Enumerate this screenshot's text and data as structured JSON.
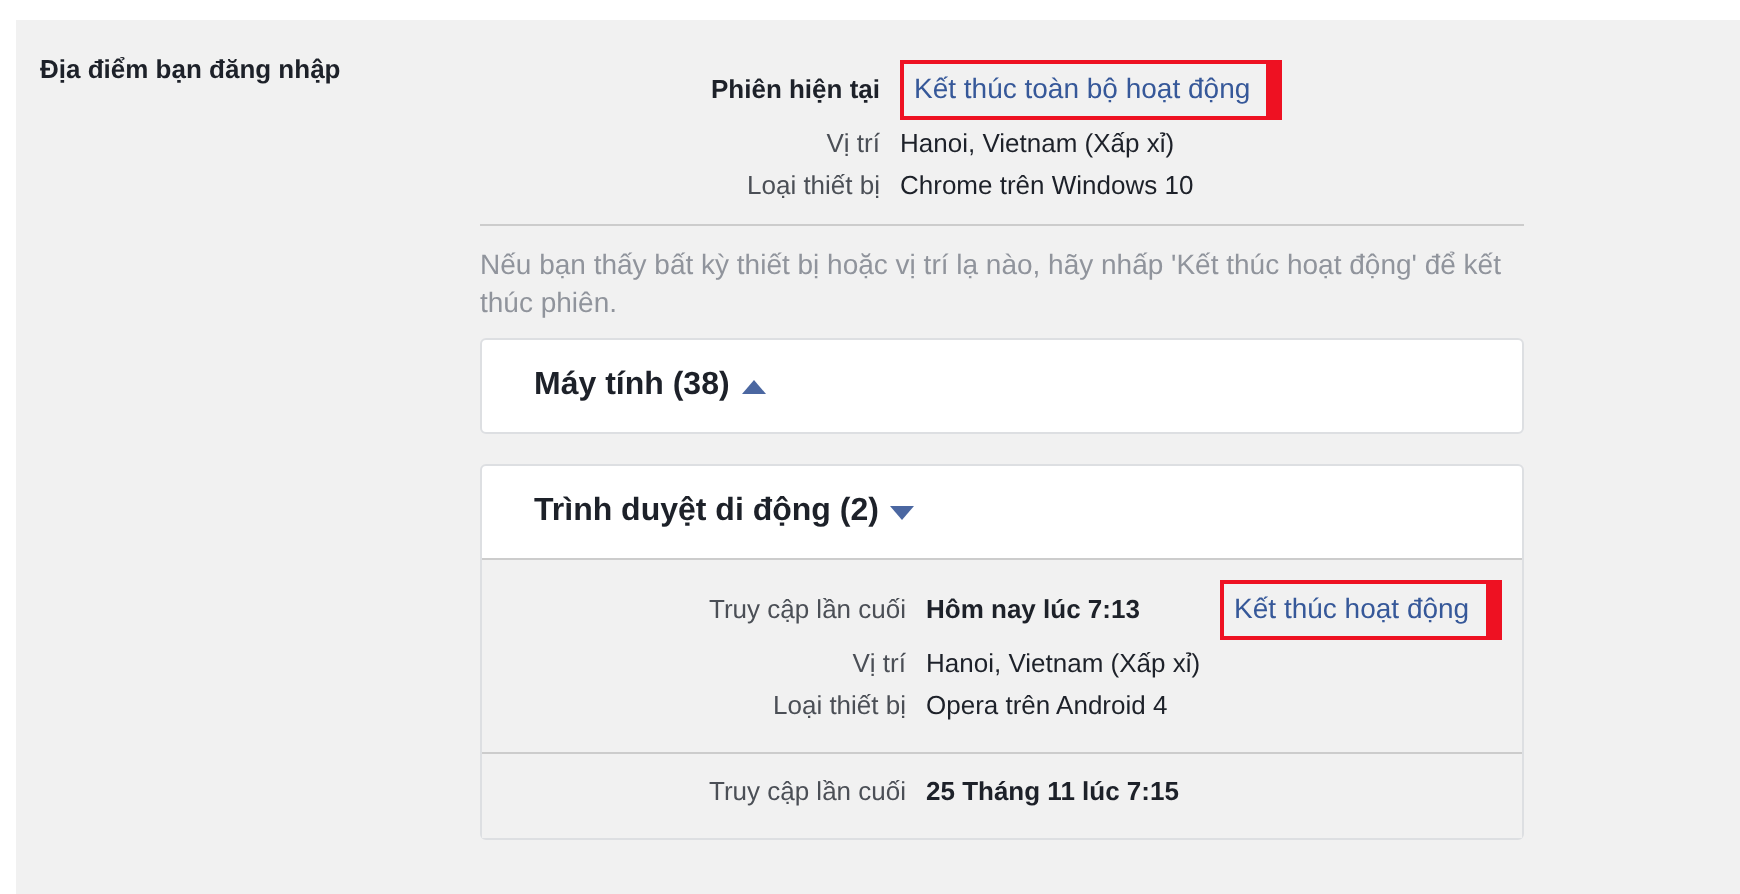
{
  "section_title": "Địa điểm bạn đăng nhập",
  "current": {
    "rows": [
      {
        "label": "Phiên hiện tại",
        "value": "",
        "kind": "header",
        "link": {
          "text": "Kết thúc toàn bộ hoạt động",
          "highlighted": true
        }
      },
      {
        "label": "Vị trí",
        "value": "Hanoi, Vietnam (Xấp xỉ)",
        "kind": "plain"
      },
      {
        "label": "Loại thiết bị",
        "value": "Chrome trên Windows 10",
        "kind": "plain"
      }
    ]
  },
  "hint": "Nếu bạn thấy bất kỳ thiết bị hoặc vị trí lạ nào, hãy nhấp 'Kết thúc hoạt động' để kết thúc phiên.",
  "groups": [
    {
      "title": "Máy tính (38)",
      "expanded": false
    },
    {
      "title": "Trình duyệt di động (2)",
      "expanded": true,
      "sessions": [
        {
          "rows": [
            {
              "label": "Truy cập lần cuối",
              "value": "Hôm nay lúc 7:13",
              "kind": "header",
              "link": {
                "text": "Kết thúc hoạt động",
                "highlighted": true
              }
            },
            {
              "label": "Vị trí",
              "value": "Hanoi, Vietnam (Xấp xỉ)",
              "kind": "plain"
            },
            {
              "label": "Loại thiết bị",
              "value": "Opera trên Android 4",
              "kind": "plain"
            }
          ]
        },
        {
          "rows": [
            {
              "label": "Truy cập lần cuối",
              "value": "25 Tháng 11 lúc 7:15",
              "kind": "header"
            }
          ]
        }
      ]
    }
  ]
}
